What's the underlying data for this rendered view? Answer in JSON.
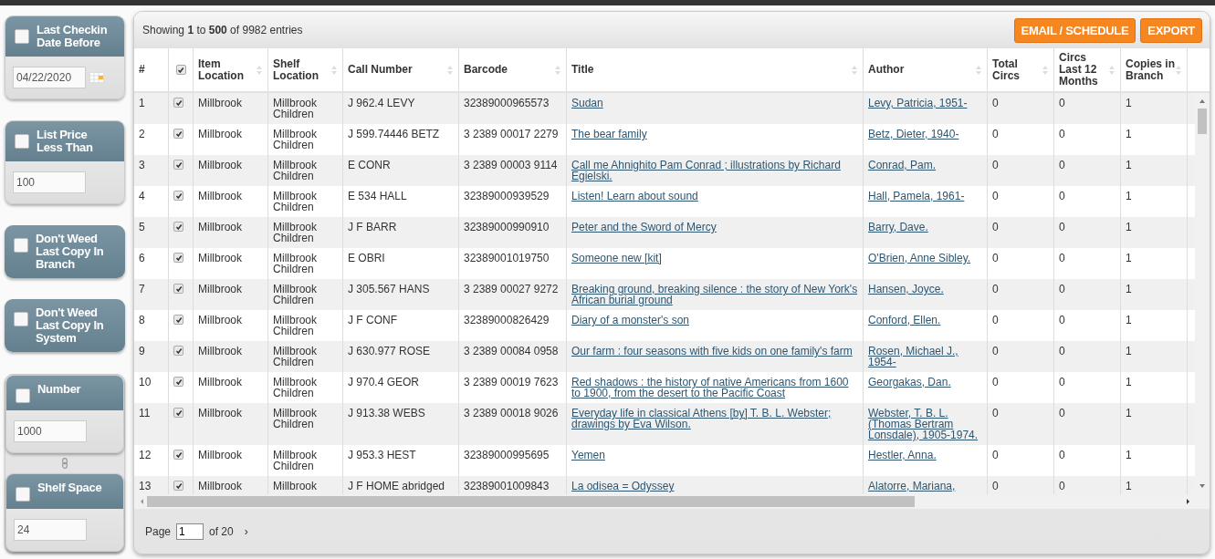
{
  "filters": [
    {
      "kind": "date",
      "label": "Last Checkin Date Before",
      "checked": false,
      "value": "04/22/2020"
    },
    {
      "kind": "input",
      "label": "List Price Less Than",
      "checked": false,
      "value": "100"
    },
    {
      "kind": "toggle",
      "label": "Don't Weed Last Copy In Branch",
      "checked": false
    },
    {
      "kind": "toggle",
      "label": "Don't Weed Last Copy In System",
      "checked": false
    }
  ],
  "linked_filters": [
    {
      "kind": "input",
      "label": "Number",
      "checked": false,
      "value": "1000"
    },
    {
      "kind": "input",
      "label": "Shelf Space",
      "checked": false,
      "value": "24"
    }
  ],
  "summary": "Showing **1** to **500** of 9982 entries",
  "buttons": [
    "EMAIL / SCHEDULE",
    "EXPORT"
  ],
  "table": {
    "select_all_checked": true,
    "columns": [
      {
        "kind": "text",
        "label": "#",
        "sortable": false
      },
      {
        "kind": "check"
      },
      {
        "kind": "text",
        "label": "Item Location",
        "sortable": true
      },
      {
        "kind": "text",
        "label": "Shelf Location",
        "sortable": true
      },
      {
        "kind": "text",
        "label": "Call Number",
        "sortable": true
      },
      {
        "kind": "text",
        "label": "Barcode",
        "sortable": true
      },
      {
        "kind": "link",
        "label": "Title",
        "sortable": true
      },
      {
        "kind": "link",
        "label": "Author",
        "sortable": true
      },
      {
        "kind": "text",
        "label": "Total Circs",
        "sortable": true
      },
      {
        "kind": "text",
        "label": "Circs Last 12 Months",
        "sortable": true
      },
      {
        "kind": "text",
        "label": "Copies in Branch",
        "sortable": true
      }
    ],
    "rows": [
      {
        "checked": true,
        "cells": [
          "1",
          "",
          "Millbrook",
          "Millbrook Children",
          "J 962.4 LEVY",
          "32389000965573",
          "Sudan",
          "Levy, Patricia, 1951-",
          "0",
          "0",
          "1"
        ]
      },
      {
        "checked": true,
        "cells": [
          "2",
          "",
          "Millbrook",
          "Millbrook Children",
          "J 599.74446 BETZ",
          "3 2389 00017 2279",
          "The bear family",
          "Betz, Dieter, 1940-",
          "0",
          "0",
          "1"
        ]
      },
      {
        "checked": true,
        "cells": [
          "3",
          "",
          "Millbrook",
          "Millbrook Children",
          "E CONR",
          "3 2389 00003 9114",
          "Call me Ahnighito Pam Conrad ; illustrations by Richard Egielski.",
          "Conrad, Pam.",
          "0",
          "0",
          "1"
        ]
      },
      {
        "checked": true,
        "cells": [
          "4",
          "",
          "Millbrook",
          "Millbrook Children",
          "E 534 HALL",
          "32389000939529",
          "Listen! Learn about sound",
          "Hall, Pamela, 1961-",
          "0",
          "0",
          "1"
        ]
      },
      {
        "checked": true,
        "cells": [
          "5",
          "",
          "Millbrook",
          "Millbrook Children",
          "J F BARR",
          "32389000990910",
          "Peter and the Sword of Mercy",
          "Barry, Dave.",
          "0",
          "0",
          "1"
        ]
      },
      {
        "checked": true,
        "cells": [
          "6",
          "",
          "Millbrook",
          "Millbrook Children",
          "E OBRI",
          "32389001019750",
          "Someone new [kit]",
          "O'Brien, Anne Sibley.",
          "0",
          "0",
          "1"
        ]
      },
      {
        "checked": true,
        "cells": [
          "7",
          "",
          "Millbrook",
          "Millbrook Children",
          "J 305.567 HANS",
          "3 2389 00027 9272",
          "Breaking ground, breaking silence : the story of New York's African burial ground",
          "Hansen, Joyce.",
          "0",
          "0",
          "1"
        ]
      },
      {
        "checked": true,
        "cells": [
          "8",
          "",
          "Millbrook",
          "Millbrook Children",
          "J F CONF",
          "32389000826429",
          "Diary of a monster's son",
          "Conford, Ellen.",
          "0",
          "0",
          "1"
        ]
      },
      {
        "checked": true,
        "cells": [
          "9",
          "",
          "Millbrook",
          "Millbrook Children",
          "J 630.977 ROSE",
          "3 2389 00084 0958",
          "Our farm : four seasons with five kids on one family's farm",
          "Rosen, Michael J., 1954-",
          "0",
          "0",
          "1"
        ]
      },
      {
        "checked": true,
        "cells": [
          "10",
          "",
          "Millbrook",
          "Millbrook Children",
          "J 970.4 GEOR",
          "3 2389 00019 7623",
          "Red shadows : the history of native Americans from 1600 to 1900, from the desert to the Pacific Coast",
          "Georgakas, Dan.",
          "0",
          "0",
          "1"
        ]
      },
      {
        "checked": true,
        "cells": [
          "11",
          "",
          "Millbrook",
          "Millbrook Children",
          "J 913.38 WEBS",
          "3 2389 00018 9026",
          "Everyday life in classical Athens [by] T. B. L. Webster; drawings by Eva Wilson.",
          "Webster, T. B. L. (Thomas Bertram Lonsdale), 1905-1974.",
          "0",
          "0",
          "1"
        ]
      },
      {
        "checked": true,
        "cells": [
          "12",
          "",
          "Millbrook",
          "Millbrook Children",
          "J 953.3 HEST",
          "32389000995695",
          "Yemen",
          "Hestler, Anna.",
          "0",
          "0",
          "1"
        ]
      },
      {
        "checked": true,
        "cells": [
          "13",
          "",
          "Millbrook",
          "Millbrook",
          "J F HOME abridged",
          "32389001009843",
          "La odisea = Odyssey",
          "Alatorre, Mariana,",
          "0",
          "0",
          "1"
        ]
      }
    ]
  },
  "pager": {
    "label": "Page",
    "value": "1",
    "total": "of 20",
    "next": "›"
  }
}
